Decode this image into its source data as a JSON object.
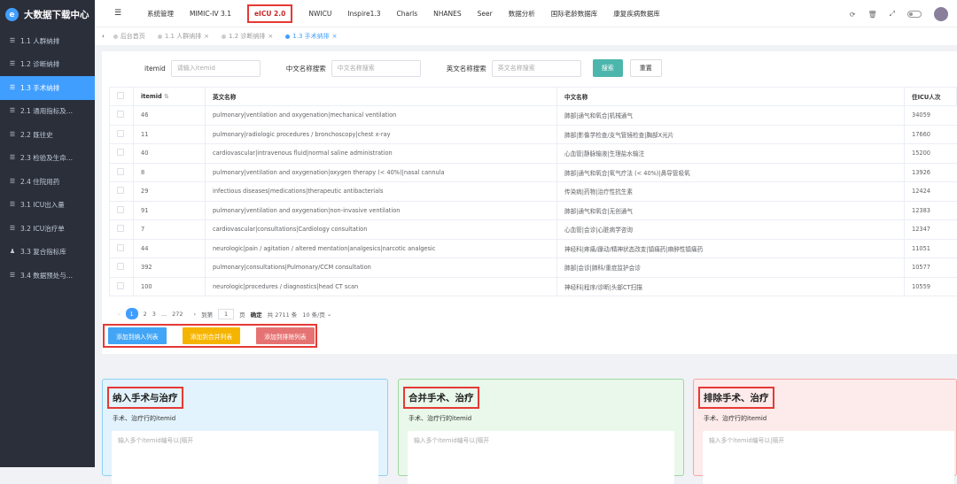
{
  "app": {
    "title": "大数据下载中心"
  },
  "sidebar": {
    "items": [
      {
        "label": "1.1 人群纳排",
        "icon": "list-icon"
      },
      {
        "label": "1.2 诊断纳排",
        "icon": "list-icon"
      },
      {
        "label": "1.3 手术纳排",
        "icon": "list-icon"
      },
      {
        "label": "2.1 通用指标及...",
        "icon": "list-icon"
      },
      {
        "label": "2.2 既往史",
        "icon": "list-icon"
      },
      {
        "label": "2.3 检验及生命...",
        "icon": "list-icon"
      },
      {
        "label": "2.4 住院用药",
        "icon": "list-icon"
      },
      {
        "label": "3.1 ICU出入量",
        "icon": "list-icon"
      },
      {
        "label": "3.2 ICU治疗单",
        "icon": "list-icon"
      },
      {
        "label": "3.3 复合指标库",
        "icon": "user-icon"
      },
      {
        "label": "3.4 数据预处与...",
        "icon": "list-icon"
      }
    ]
  },
  "topnav": {
    "items": [
      "系统管理",
      "MIMIC-IV 3.1",
      "eICU 2.0",
      "NWICU",
      "Inspire1.3",
      "Charls",
      "NHANES",
      "Seer",
      "数据分析",
      "国际老龄数据库",
      "康复疾病数据库"
    ]
  },
  "tabs": [
    "后台首页",
    "1.1 人群纳排",
    "1.2 诊断纳排",
    "1.3 手术纳排"
  ],
  "search": {
    "itemid_label": "itemid",
    "itemid_placeholder": "请输入itemid",
    "cn_label": "中文名称搜索",
    "cn_placeholder": "中文名称搜索",
    "en_label": "英文名称搜索",
    "en_placeholder": "英文名称搜索",
    "search_btn": "搜索",
    "reset_btn": "重置"
  },
  "table": {
    "headers": [
      "itemid",
      "英文名称",
      "中文名称",
      "住ICU人次"
    ],
    "rows": [
      [
        "46",
        "pulmonary|ventilation and oxygenation|mechanical ventilation",
        "肺部|通气和氧合|机械通气",
        "34059"
      ],
      [
        "11",
        "pulmonary|radiologic procedures / bronchoscopy|chest x-ray",
        "肺部|影像学检查/支气管镜检查|胸部X光片",
        "17660"
      ],
      [
        "40",
        "cardiovascular|intravenous fluid|normal saline administration",
        "心血管|静脉输液|生理盐水输注",
        "15200"
      ],
      [
        "8",
        "pulmonary|ventilation and oxygenation|oxygen therapy (< 40%)|nasal cannula",
        "肺部|通气和氧合|氧气疗法 (< 40%)|鼻导管吸氧",
        "13926"
      ],
      [
        "29",
        "infectious diseases|medications|therapeutic antibacterials",
        "传染病|药物|治疗性抗生素",
        "12424"
      ],
      [
        "91",
        "pulmonary|ventilation and oxygenation|non-invasive ventilation",
        "肺部|通气和氧合|无创通气",
        "12383"
      ],
      [
        "7",
        "cardiovascular|consultations|Cardiology consultation",
        "心血管|会诊|心脏病学咨询",
        "12347"
      ],
      [
        "44",
        "neurologic|pain / agitation / altered mentation|analgesics|narcotic analgesic",
        "神经科|疼痛/躁动/精神状态改变|镇痛药|麻醉性镇痛药",
        "11051"
      ],
      [
        "392",
        "pulmonary|consultations|Pulmonary/CCM consultation",
        "肺部|会诊|肺科/重症监护会诊",
        "10577"
      ],
      [
        "100",
        "neurologic|procedures / diagnostics|head CT scan",
        "神经科|程序/诊断|头部CT扫描",
        "10559"
      ]
    ]
  },
  "pager": {
    "p1": "1",
    "p2": "2",
    "p3": "3",
    "dots": "...",
    "last": "272",
    "goto": "到第",
    "page_val": "1",
    "page_unit": "页",
    "confirm": "确定",
    "total": "共 2711 条",
    "size": "10 条/页"
  },
  "actions": {
    "include": "添加到纳入列表",
    "merge": "添加到合并列表",
    "exclude": "添加到排除列表"
  },
  "cards": [
    {
      "title": "纳入手术与治疗",
      "sub": "手术、治疗行的itemid",
      "placeholder": "输入多个itemid编号以|隔开"
    },
    {
      "title": "合并手术、治疗",
      "sub": "手术、治疗行的itemid",
      "placeholder": "输入多个itemid编号以|隔开"
    },
    {
      "title": "排除手术、治疗",
      "sub": "手术、治疗行的itemid",
      "placeholder": "输入多个itemid编号以|隔开"
    }
  ],
  "colors": {
    "primary": "#409eff",
    "teal": "#4db6ac",
    "orange": "#f5b400",
    "red": "#e57373",
    "sidebar": "#2b2f3a"
  }
}
